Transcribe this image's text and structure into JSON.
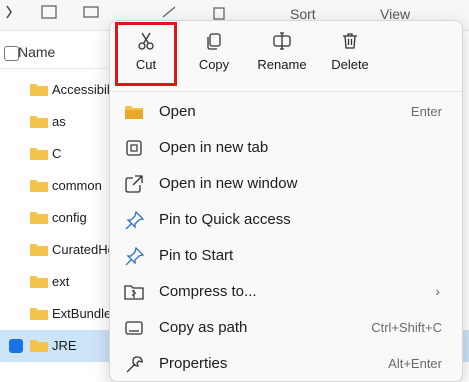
{
  "toolbar": {
    "sort_label": "Sort",
    "view_label": "View"
  },
  "file_list": {
    "header": "Name",
    "rows": [
      {
        "name": "Accessibili",
        "value": "1"
      },
      {
        "name": "as",
        "value": "1"
      },
      {
        "name": "C",
        "value": "1"
      },
      {
        "name": "common",
        "value": "1"
      },
      {
        "name": "config",
        "value": "1"
      },
      {
        "name": "CuratedHe",
        "value": "1"
      },
      {
        "name": "ext",
        "value": "1"
      },
      {
        "name": "ExtBundles",
        "value": "1"
      },
      {
        "name": "JRE",
        "value": "1"
      }
    ]
  },
  "context_menu": {
    "quick_actions": [
      {
        "label": "Cut",
        "icon": "scissors-icon"
      },
      {
        "label": "Copy",
        "icon": "copy-icon"
      },
      {
        "label": "Rename",
        "icon": "rename-icon"
      },
      {
        "label": "Delete",
        "icon": "trash-icon"
      }
    ],
    "items": [
      {
        "label": "Open",
        "shortcut": "Enter",
        "icon": "folder-icon"
      },
      {
        "label": "Open in new tab",
        "shortcut": "",
        "icon": "new-tab-icon"
      },
      {
        "label": "Open in new window",
        "shortcut": "",
        "icon": "new-window-icon"
      },
      {
        "label": "Pin to Quick access",
        "shortcut": "",
        "icon": "pin-icon"
      },
      {
        "label": "Pin to Start",
        "shortcut": "",
        "icon": "pin-start-icon"
      },
      {
        "label": "Compress to...",
        "shortcut": "",
        "icon": "archive-icon"
      },
      {
        "label": "Copy as path",
        "shortcut": "Ctrl+Shift+C",
        "icon": "path-icon"
      },
      {
        "label": "Properties",
        "shortcut": "Alt+Enter",
        "icon": "wrench-icon"
      }
    ]
  },
  "colors": {
    "highlight_border": "#e0141b",
    "selected_row": "#cce4f7",
    "folder": "#f4c34b"
  }
}
